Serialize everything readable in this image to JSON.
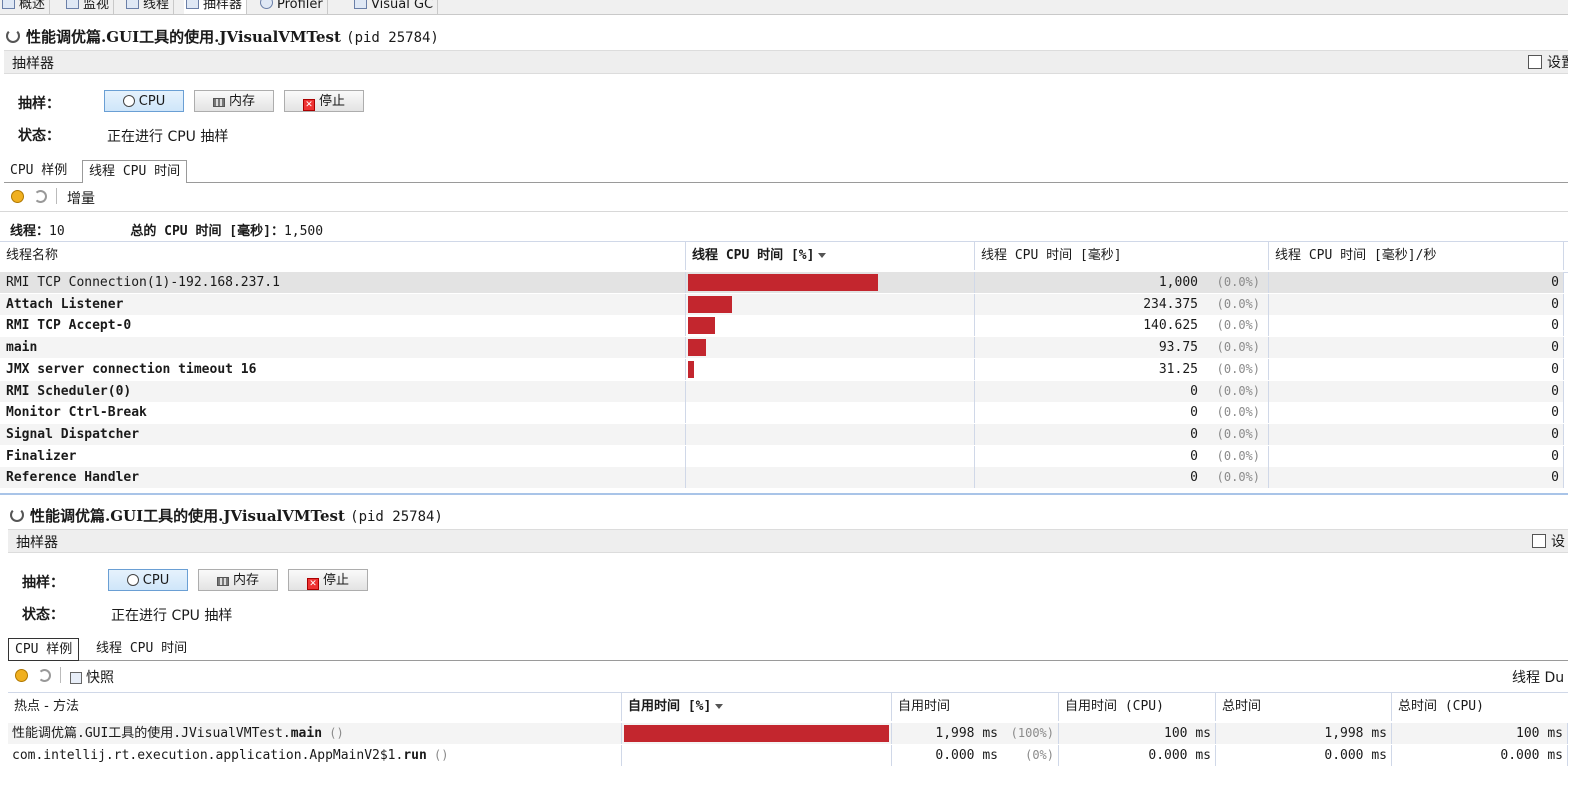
{
  "top_tabs": [
    "概述",
    "监视",
    "线程",
    "抽样器",
    "Profiler",
    "Visual GC"
  ],
  "panel1": {
    "title": "性能调优篇.GUI工具的使用.JVisualVMTest",
    "pid": "(pid 25784)",
    "section": "抽样器",
    "settings": "设置",
    "sample_label": "抽样：",
    "buttons": {
      "cpu": "CPU",
      "memory": "内存",
      "stop": "停止"
    },
    "status_label": "状态：",
    "status_value": "正在进行 CPU 抽样",
    "subtabs": [
      "CPU 样例",
      "线程 CPU 时间"
    ],
    "toolbar_delta": "增量",
    "threads_label": "线程：",
    "threads_value": "10",
    "total_label": "总的 CPU 时间 [毫秒]：",
    "total_value": "1,500",
    "columns": [
      "线程名称",
      "线程 CPU 时间 [%]",
      "线程 CPU 时间 [毫秒]",
      "线程 CPU 时间 [毫秒]/秒"
    ],
    "rows": [
      {
        "name": "RMI TCP Connection(1)-192.168.237.1",
        "pct": 0.667,
        "ms": "1,000",
        "p": "(0.0%)",
        "rate": "0"
      },
      {
        "name": "Attach Listener",
        "pct": 0.156,
        "ms": "234.375",
        "p": "(0.0%)",
        "rate": "0"
      },
      {
        "name": "RMI TCP Accept-0",
        "pct": 0.094,
        "ms": "140.625",
        "p": "(0.0%)",
        "rate": "0"
      },
      {
        "name": "main",
        "pct": 0.0625,
        "ms": "93.75",
        "p": "(0.0%)",
        "rate": "0"
      },
      {
        "name": "JMX server connection timeout 16",
        "pct": 0.021,
        "ms": "31.25",
        "p": "(0.0%)",
        "rate": "0"
      },
      {
        "name": "RMI Scheduler(0)",
        "pct": 0,
        "ms": "0",
        "p": "(0.0%)",
        "rate": "0"
      },
      {
        "name": "Monitor Ctrl-Break",
        "pct": 0,
        "ms": "0",
        "p": "(0.0%)",
        "rate": "0"
      },
      {
        "name": "Signal Dispatcher",
        "pct": 0,
        "ms": "0",
        "p": "(0.0%)",
        "rate": "0"
      },
      {
        "name": "Finalizer",
        "pct": 0,
        "ms": "0",
        "p": "(0.0%)",
        "rate": "0"
      },
      {
        "name": "Reference Handler",
        "pct": 0,
        "ms": "0",
        "p": "(0.0%)",
        "rate": "0"
      }
    ]
  },
  "panel2": {
    "title": "性能调优篇.GUI工具的使用.JVisualVMTest",
    "pid": "(pid 25784)",
    "section": "抽样器",
    "settings": "设",
    "sample_label": "抽样：",
    "buttons": {
      "cpu": "CPU",
      "memory": "内存",
      "stop": "停止"
    },
    "status_label": "状态：",
    "status_value": "正在进行 CPU 抽样",
    "subtabs": [
      "CPU 样例",
      "线程 CPU 时间"
    ],
    "toolbar_snapshot": "快照",
    "thread_dump": "线程 Du",
    "columns": [
      "热点 - 方法",
      "自用时间 [%]",
      "自用时间",
      "自用时间 (CPU)",
      "总时间",
      "总时间 (CPU)"
    ],
    "rows": [
      {
        "prefix": "性能调优篇.GUI工具的使用.JVisualVMTest.",
        "method": "main",
        "suffix": " ()",
        "pct": 1.0,
        "self": "1,998 ms",
        "p": "(100%)",
        "self_cpu": "100 ms",
        "total": "1,998 ms",
        "total_cpu": "100 ms"
      },
      {
        "prefix": "com.intellij.rt.execution.application.AppMainV2$1.",
        "method": "run",
        "suffix": " ()",
        "pct": 0,
        "self": "0.000 ms",
        "p": "(0%)",
        "self_cpu": "0.000 ms",
        "total": "0.000 ms",
        "total_cpu": "0.000 ms"
      }
    ]
  },
  "colors": {
    "bar": "#c3262e",
    "selected_button": "#cfe6fa"
  }
}
